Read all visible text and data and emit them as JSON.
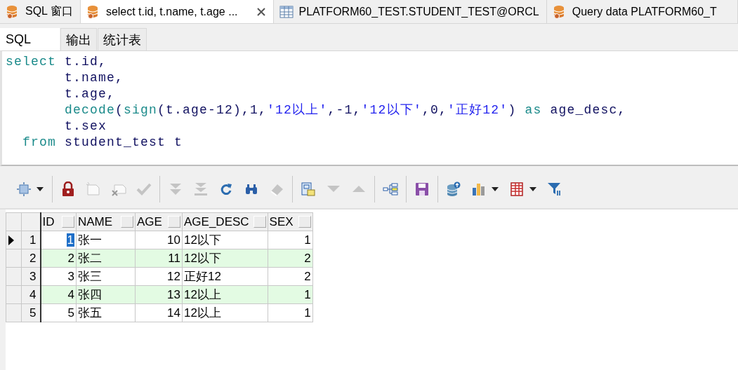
{
  "tabs": [
    {
      "label": "SQL 窗口",
      "kind": "query",
      "selected": false
    },
    {
      "label": "select t.id, t.name, t.age ...",
      "kind": "query",
      "selected": true
    },
    {
      "label": "PLATFORM60_TEST.STUDENT_TEST@ORCL",
      "kind": "table",
      "selected": false
    },
    {
      "label": "Query data PLATFORM60_T",
      "kind": "query",
      "selected": false
    }
  ],
  "sub_tabs": [
    {
      "label": "SQL",
      "selected": true
    },
    {
      "label": "输出",
      "selected": false
    },
    {
      "label": "统计表",
      "selected": false
    }
  ],
  "editor": {
    "lines": [
      [
        {
          "kind": "keyword",
          "text": "select "
        },
        {
          "kind": "plain",
          "text": "t.id,"
        }
      ],
      [
        {
          "kind": "plain",
          "text": "       t.name,"
        }
      ],
      [
        {
          "kind": "plain",
          "text": "       t.age,"
        }
      ],
      [
        {
          "kind": "keyword",
          "text": "       decode"
        },
        {
          "kind": "plain",
          "text": "("
        },
        {
          "kind": "keyword",
          "text": "sign"
        },
        {
          "kind": "plain",
          "text": "(t.age-12),1,"
        },
        {
          "kind": "string",
          "text": "'12以上'"
        },
        {
          "kind": "plain",
          "text": ",-1,"
        },
        {
          "kind": "string",
          "text": "'12以下'"
        },
        {
          "kind": "plain",
          "text": ",0,"
        },
        {
          "kind": "string",
          "text": "'正好12'"
        },
        {
          "kind": "plain",
          "text": ") "
        },
        {
          "kind": "keyword",
          "text": "as"
        },
        {
          "kind": "plain",
          "text": " age_desc,"
        }
      ],
      [
        {
          "kind": "plain",
          "text": "       t.sex"
        }
      ],
      [
        {
          "kind": "keyword",
          "text": "  from"
        },
        {
          "kind": "plain",
          "text": " student_test t"
        }
      ]
    ]
  },
  "toolbar": {
    "groups": [
      {
        "buttons": [
          {
            "disabled": false,
            "dropdown": true
          }
        ]
      },
      {
        "buttons": [
          {
            "disabled": false,
            "dropdown": false
          },
          {
            "disabled": true,
            "dropdown": false
          },
          {
            "disabled": true,
            "dropdown": false
          },
          {
            "disabled": true,
            "dropdown": false
          }
        ]
      },
      {
        "buttons": [
          {
            "disabled": true,
            "dropdown": false
          },
          {
            "disabled": true,
            "dropdown": false
          },
          {
            "disabled": false,
            "dropdown": false
          },
          {
            "disabled": false,
            "dropdown": false
          },
          {
            "disabled": true,
            "dropdown": false
          }
        ]
      },
      {
        "buttons": [
          {
            "disabled": false,
            "dropdown": false
          },
          {
            "disabled": true,
            "dropdown": false
          },
          {
            "disabled": true,
            "dropdown": false
          }
        ]
      },
      {
        "buttons": [
          {
            "disabled": false,
            "dropdown": false
          }
        ]
      },
      {
        "buttons": [
          {
            "disabled": false,
            "dropdown": false
          }
        ]
      },
      {
        "buttons": [
          {
            "disabled": false,
            "dropdown": false
          },
          {
            "disabled": false,
            "dropdown": true
          },
          {
            "disabled": false,
            "dropdown": true
          },
          {
            "disabled": false,
            "dropdown": false
          }
        ]
      }
    ]
  },
  "grid": {
    "columns": [
      {
        "label": "ID",
        "kind": "number"
      },
      {
        "label": "NAME",
        "kind": "text"
      },
      {
        "label": "AGE",
        "kind": "number"
      },
      {
        "label": "AGE_DESC",
        "kind": "text"
      },
      {
        "label": "SEX",
        "kind": "number"
      }
    ],
    "rows": [
      {
        "number": "1",
        "selected": true,
        "cells": [
          {
            "text": "1",
            "focused": true
          },
          {
            "text": "张一",
            "focused": false
          },
          {
            "text": "10",
            "focused": false
          },
          {
            "text": "12以下",
            "focused": false
          },
          {
            "text": "1",
            "focused": false
          }
        ]
      },
      {
        "number": "2",
        "selected": false,
        "cells": [
          {
            "text": "2",
            "focused": false
          },
          {
            "text": "张二",
            "focused": false
          },
          {
            "text": "11",
            "focused": false
          },
          {
            "text": "12以下",
            "focused": false
          },
          {
            "text": "2",
            "focused": false
          }
        ]
      },
      {
        "number": "3",
        "selected": false,
        "cells": [
          {
            "text": "3",
            "focused": false
          },
          {
            "text": "张三",
            "focused": false
          },
          {
            "text": "12",
            "focused": false
          },
          {
            "text": "正好12",
            "focused": false
          },
          {
            "text": "2",
            "focused": false
          }
        ]
      },
      {
        "number": "4",
        "selected": false,
        "cells": [
          {
            "text": "4",
            "focused": false
          },
          {
            "text": "张四",
            "focused": false
          },
          {
            "text": "13",
            "focused": false
          },
          {
            "text": "12以上",
            "focused": false
          },
          {
            "text": "1",
            "focused": false
          }
        ]
      },
      {
        "number": "5",
        "selected": false,
        "cells": [
          {
            "text": "5",
            "focused": false
          },
          {
            "text": "张五",
            "focused": false
          },
          {
            "text": "14",
            "focused": false
          },
          {
            "text": "12以上",
            "focused": false
          },
          {
            "text": "1",
            "focused": false
          }
        ]
      }
    ]
  }
}
